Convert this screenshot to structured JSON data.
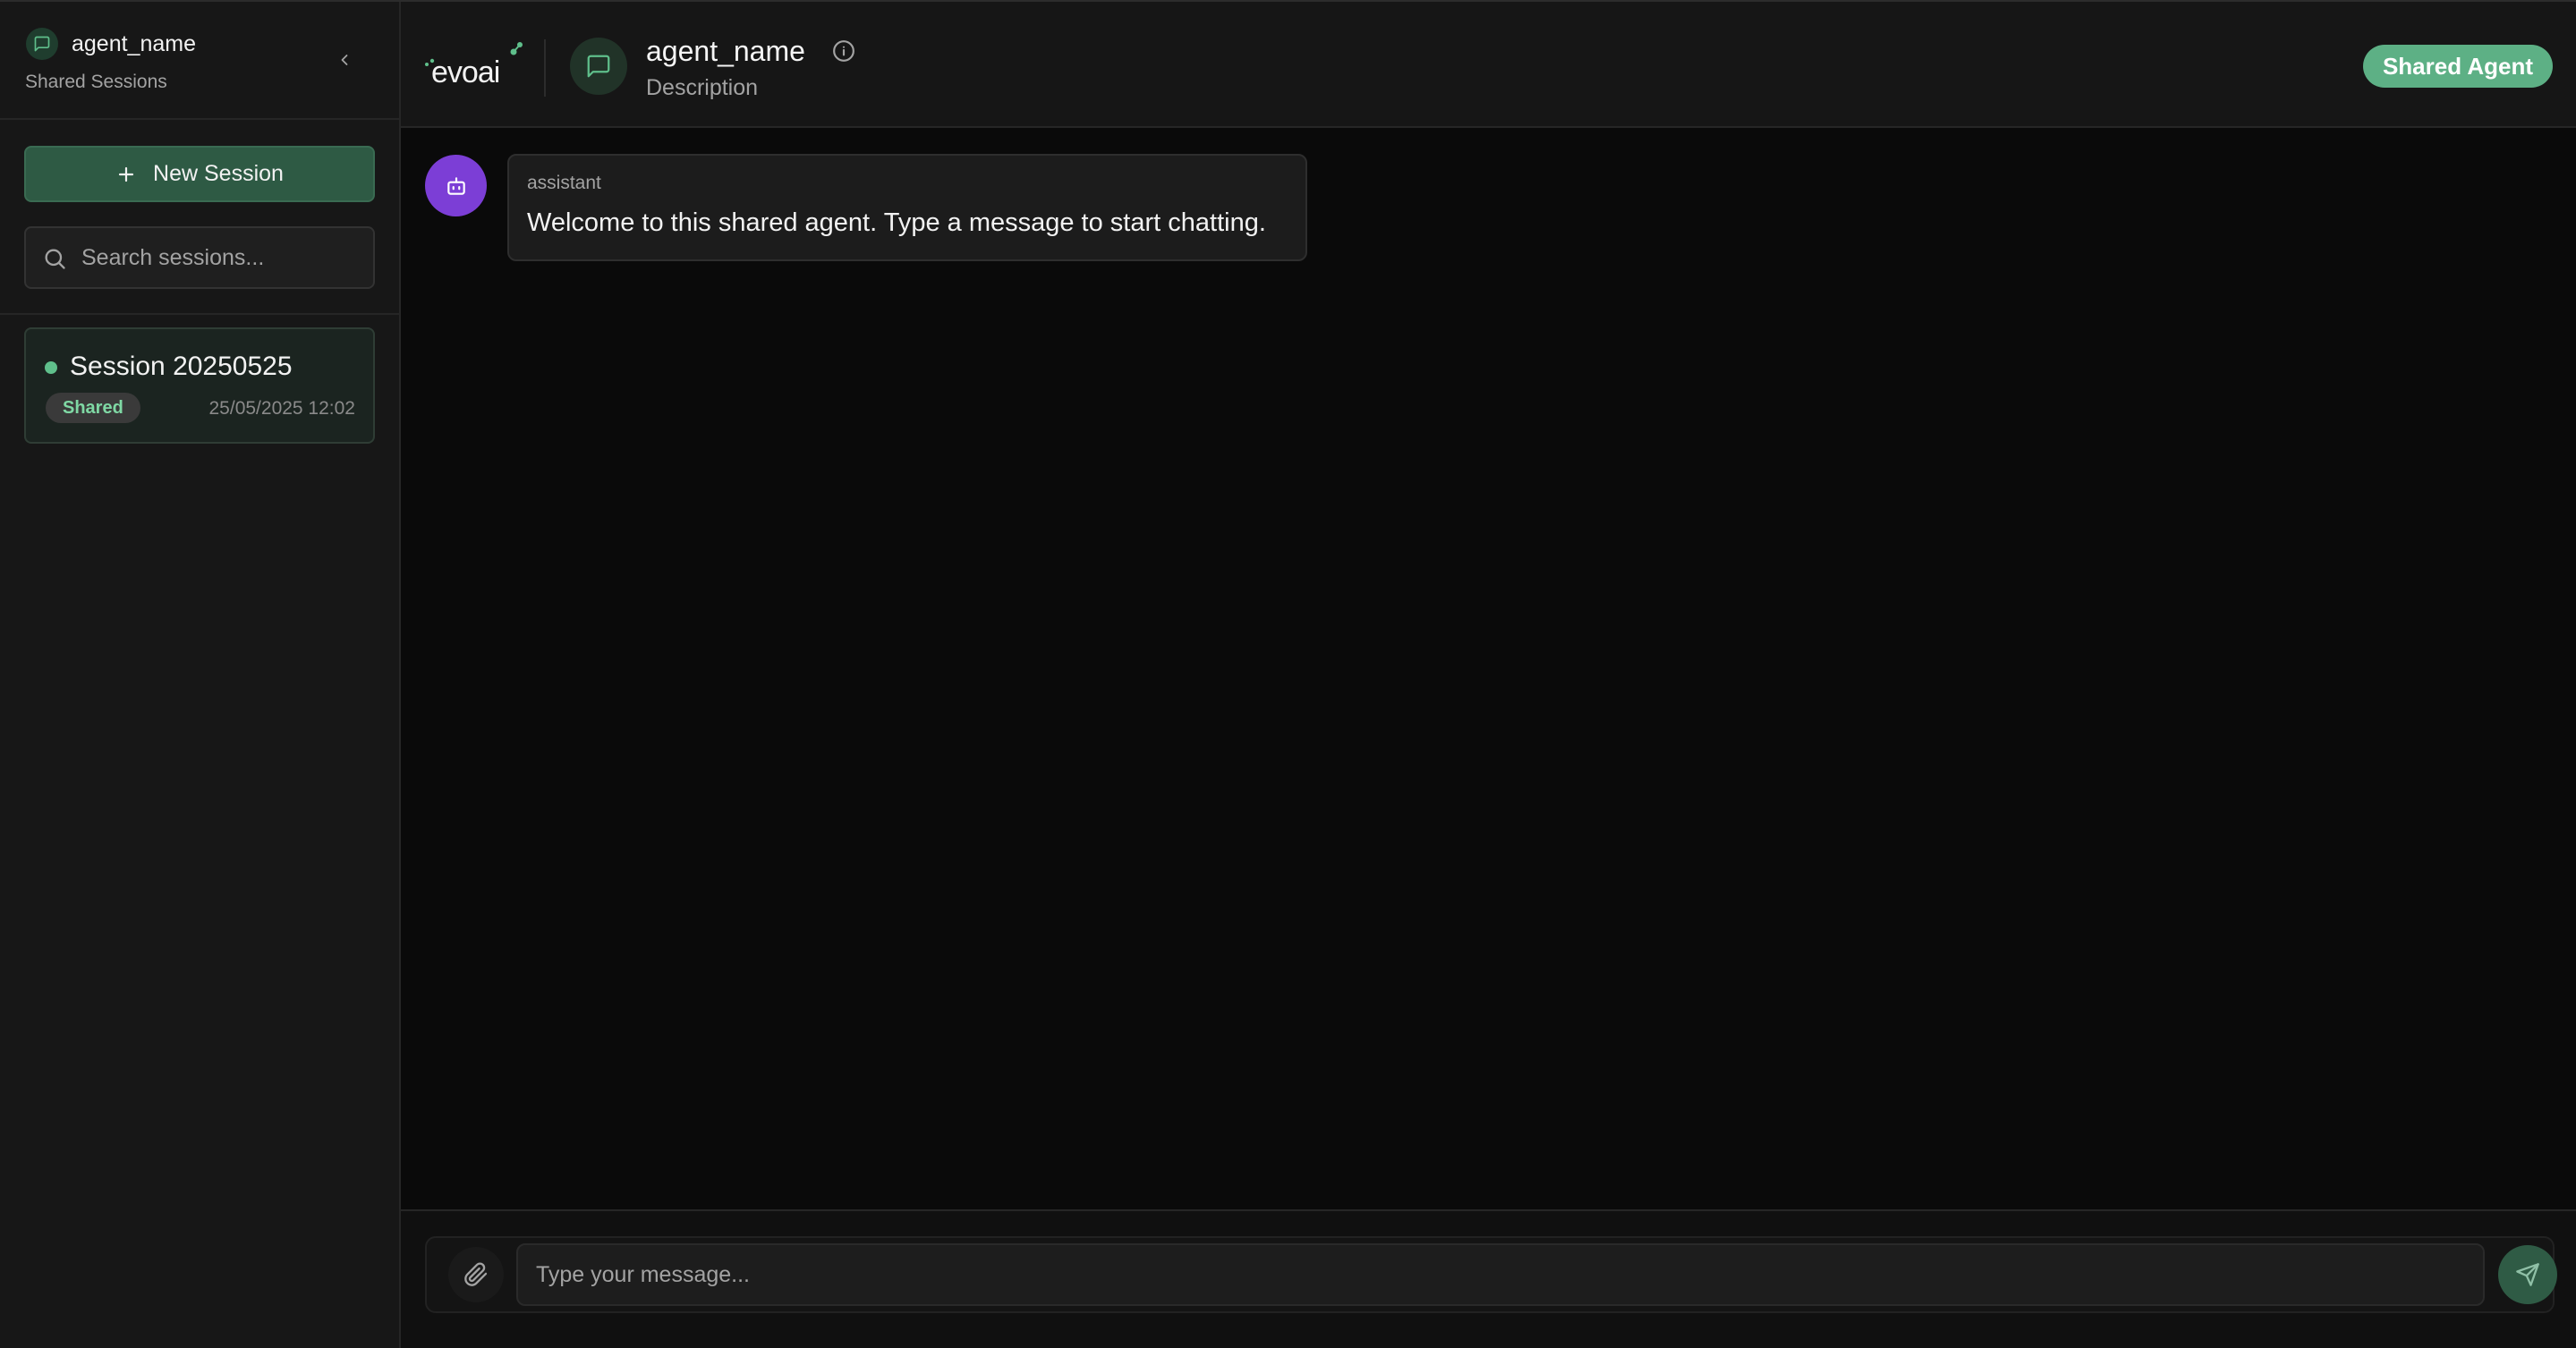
{
  "sidebar": {
    "agent_name": "agent_name",
    "subtitle": "Shared Sessions",
    "new_session_label": "New Session",
    "search_placeholder": "Search sessions...",
    "sessions": [
      {
        "title": "Session 20250525",
        "badge": "Shared",
        "date": "25/05/2025 12:02"
      }
    ]
  },
  "header": {
    "logo_text": "evoai",
    "agent_name": "agent_name",
    "description": "Description",
    "pill_label": "Shared Agent"
  },
  "chat": {
    "messages": [
      {
        "role": "assistant",
        "text": "Welcome to this shared agent. Type a message to start chatting."
      }
    ],
    "input_placeholder": "Type your message..."
  },
  "colors": {
    "accent_green": "#5db085",
    "button_green": "#2e5a44",
    "bot_avatar_purple": "#7c3ed6",
    "background": "#0a0a0a",
    "sidebar_bg": "#171717"
  },
  "icons": {
    "sidebar_header": "message-square-icon",
    "collapse": "chevron-left-icon",
    "new_session": "plus-icon",
    "search": "search-icon",
    "agent_avatar": "message-square-icon",
    "info": "info-icon",
    "bot": "bot-icon",
    "attach": "paperclip-icon",
    "send": "send-icon"
  }
}
